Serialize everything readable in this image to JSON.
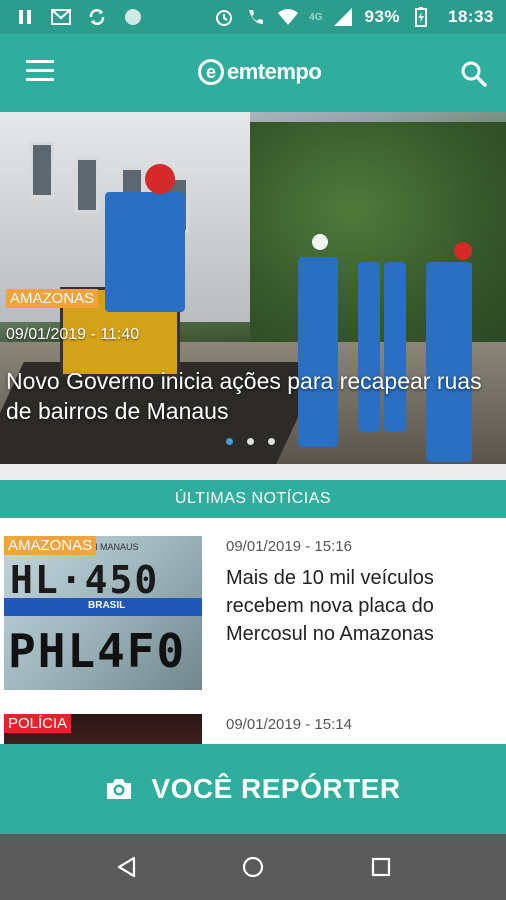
{
  "status_bar": {
    "battery_percent": "93%",
    "time": "18:33",
    "network_label": "4G",
    "icons": [
      "pause-icon",
      "mail-icon",
      "sync-icon",
      "circle-icon",
      "alarm-icon",
      "wifi-call-icon",
      "wifi-icon",
      "signal-icon",
      "battery-charging-icon"
    ]
  },
  "app_bar": {
    "logo_text": "emtempo",
    "menu_icon": "hamburger-menu-icon",
    "search_icon": "search-icon"
  },
  "hero": {
    "category": "AMAZONAS",
    "category_color": "#f2a33c",
    "date": "09/01/2019 - 11:40",
    "title": "Novo Governo inicia ações para recapear ruas de bairros de Manaus",
    "slides": 3,
    "active_slide": 1
  },
  "section": {
    "title": "ÚLTIMAS NOTÍCIAS"
  },
  "news": [
    {
      "category": "AMAZONAS",
      "category_color": "#f2a33c",
      "date": "09/01/2019 - 15:16",
      "title": "Mais de 10 mil veículos recebem nova placa do Mercosul no Amazonas",
      "plate_line1": "HL·450",
      "plate_line2": "PHL4F0",
      "plate_small": "AM MANAUS",
      "plate_band": "BRASIL"
    },
    {
      "category": "POLÍCIA",
      "category_color": "#e8212f",
      "date": "09/01/2019 - 15:14",
      "title": ""
    }
  ],
  "reporter_button": {
    "label": "VOCÊ REPÓRTER",
    "icon": "camera-icon"
  },
  "nav": {
    "icons": [
      "back-icon",
      "home-icon",
      "recents-icon"
    ]
  },
  "colors": {
    "primary": "#2fae9d",
    "status_bar": "#2b9d8c",
    "nav_bar": "#5a5a5a"
  }
}
